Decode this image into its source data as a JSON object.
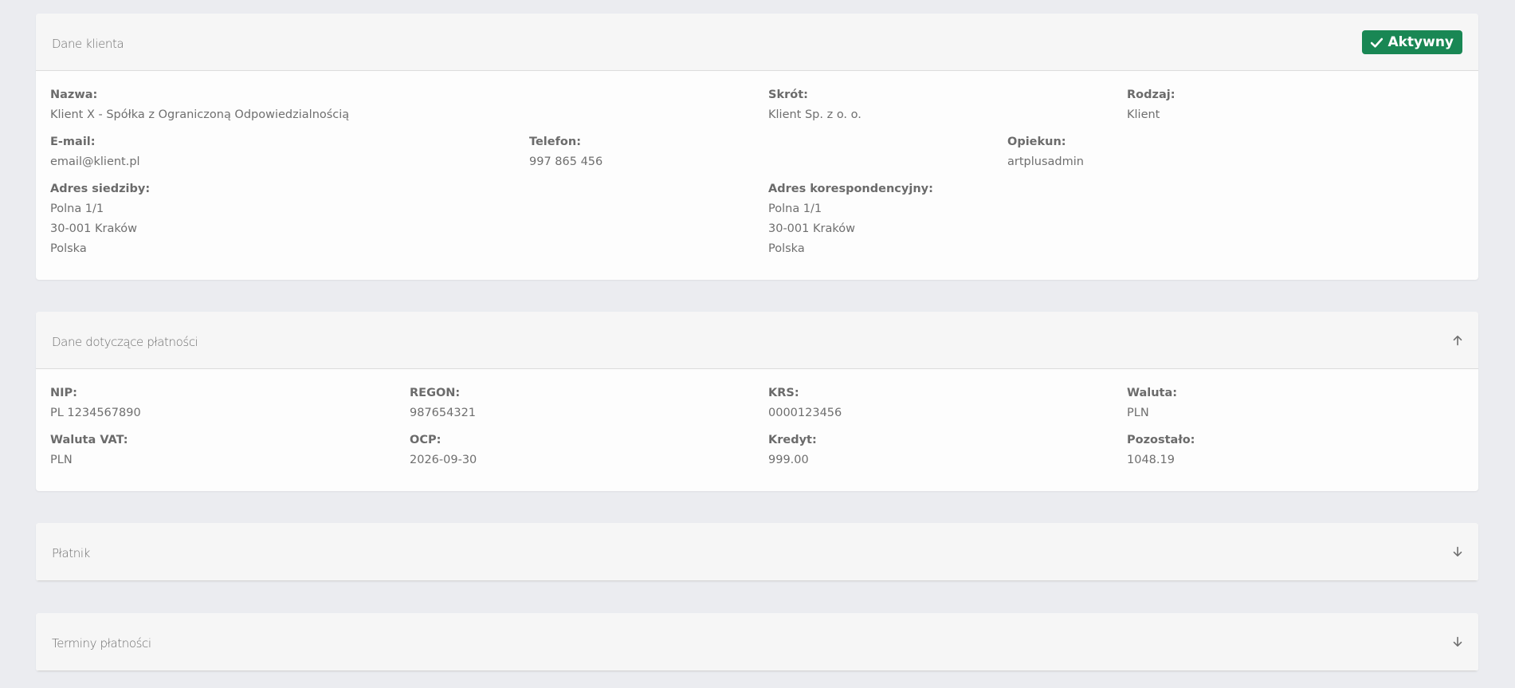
{
  "client_card": {
    "title": "Dane klienta",
    "status_badge": "Aktywny",
    "fields": {
      "name": {
        "label": "Nazwa:",
        "value": "Klient X - Spółka z Ograniczoną Odpowiedzialnością"
      },
      "short": {
        "label": "Skrót:",
        "value": "Klient Sp. z o. o."
      },
      "kind": {
        "label": "Rodzaj:",
        "value": "Klient"
      },
      "email": {
        "label": "E-mail:",
        "value": "email@klient.pl"
      },
      "phone": {
        "label": "Telefon:",
        "value": "997 865 456"
      },
      "guardian": {
        "label": "Opiekun:",
        "value": "artplusadmin"
      },
      "seat_address": {
        "label": "Adres siedziby:",
        "lines": [
          "Polna 1/1",
          "30-001 Kraków",
          "Polska"
        ]
      },
      "mail_address": {
        "label": "Adres korespondencyjny:",
        "lines": [
          "Polna 1/1",
          "30-001 Kraków",
          "Polska"
        ]
      }
    }
  },
  "payment_card": {
    "title": "Dane dotyczące płatności",
    "toggle_icon": "arrow-up-icon",
    "fields": {
      "nip": {
        "label": "NIP:",
        "value": "PL 1234567890"
      },
      "regon": {
        "label": "REGON:",
        "value": "987654321"
      },
      "krs": {
        "label": "KRS:",
        "value": "0000123456"
      },
      "currency": {
        "label": "Waluta:",
        "value": "PLN"
      },
      "vat_currency": {
        "label": "Waluta VAT:",
        "value": "PLN"
      },
      "ocp": {
        "label": "OCP:",
        "value": "2026-09-30"
      },
      "credit": {
        "label": "Kredyt:",
        "value": "999.00"
      },
      "remaining": {
        "label": "Pozostało:",
        "value": "1048.19"
      }
    }
  },
  "payer_card": {
    "title": "Płatnik",
    "toggle_icon": "arrow-down-icon"
  },
  "terms_card": {
    "title": "Terminy płatności",
    "toggle_icon": "arrow-down-icon"
  },
  "colors": {
    "page_background": "#ebecf0",
    "card_header": "#f6f6f6",
    "badge_success": "#198754",
    "text": "#6b6b6b"
  }
}
